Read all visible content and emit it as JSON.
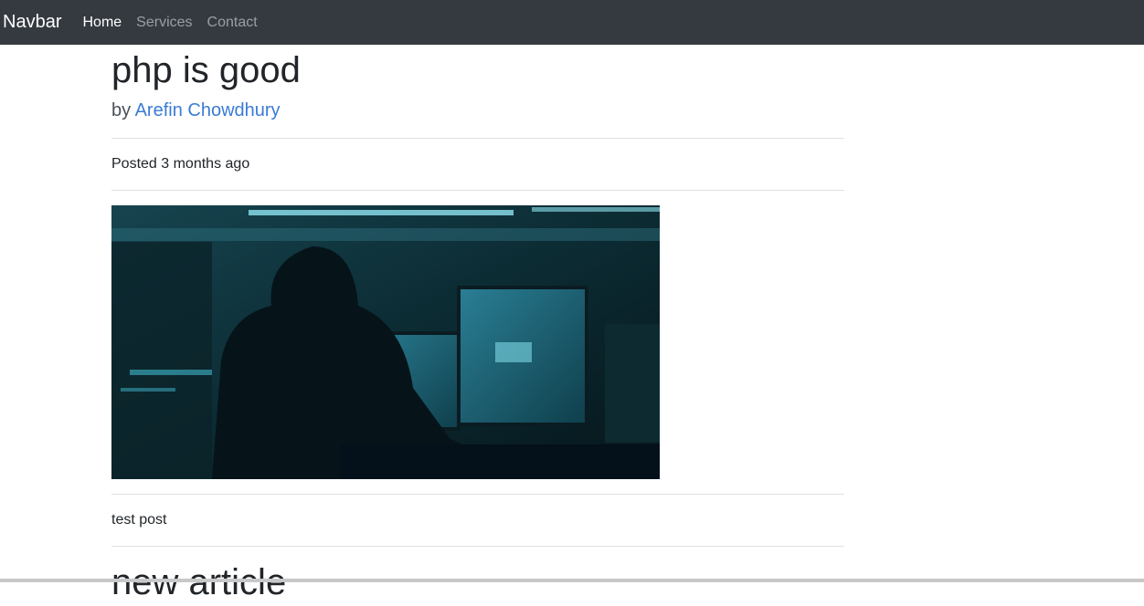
{
  "navbar": {
    "brand": "Navbar",
    "links": [
      {
        "label": "Home",
        "active": true
      },
      {
        "label": "Services",
        "active": false
      },
      {
        "label": "Contact",
        "active": false
      }
    ]
  },
  "post": {
    "title": "php is good",
    "by_prefix": "by",
    "author": "Arefin Chowdhury",
    "posted": "Posted 3 months ago",
    "image_alt": "hooded hacker at computer monitors",
    "body": "test post"
  },
  "next_post": {
    "title_partial": "new article"
  },
  "colors": {
    "navbar_bg": "#343a40",
    "link_accent": "#3a7bd5"
  }
}
